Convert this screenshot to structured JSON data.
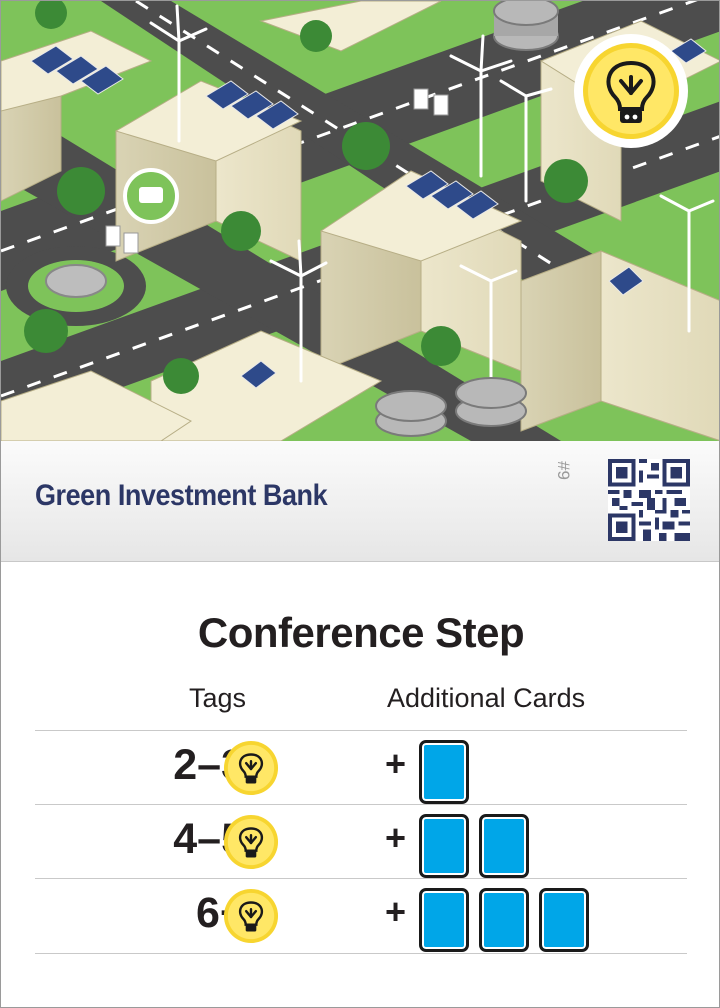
{
  "card": {
    "title": "Green Investment Bank",
    "number": "#9",
    "section_heading": "Conference Step",
    "columns": {
      "tags": "Tags",
      "cards": "Additional Cards"
    },
    "rows": [
      {
        "range": "2–3",
        "extra_cards": 1
      },
      {
        "range": "4–5",
        "extra_cards": 2
      },
      {
        "range": "6+",
        "extra_cards": 3
      }
    ],
    "plus": "+",
    "icon": "lightbulb-icon",
    "colors": {
      "title": "#2c3766",
      "card_blue": "#00a6e8",
      "bulb_yellow": "#f7d530",
      "grass": "#7ec35a",
      "road": "#4a4a4a"
    }
  }
}
